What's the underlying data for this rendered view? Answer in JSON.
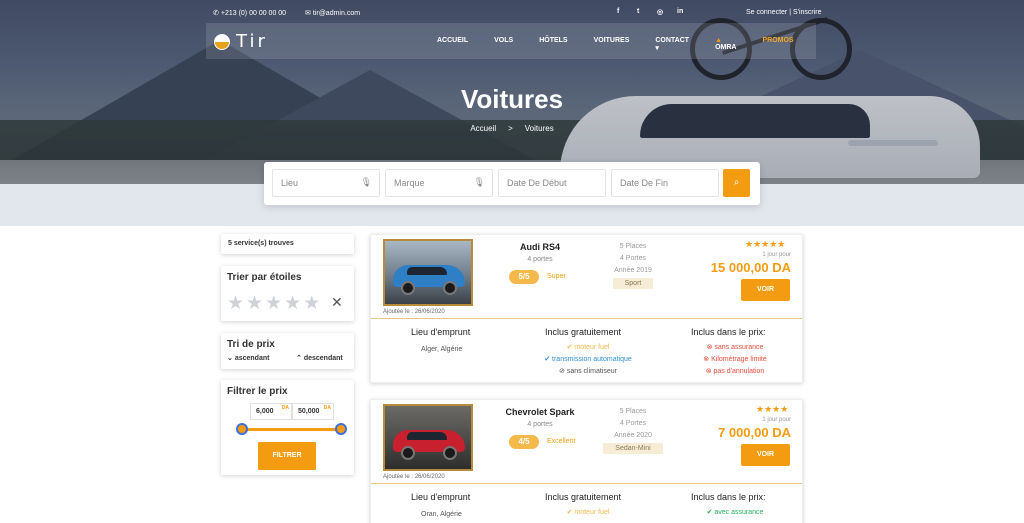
{
  "topbar": {
    "phone": "+213 (0) 00 00 00 00",
    "email": "tir@admin.com",
    "auth": "Se connecter | S'inscrire",
    "social": [
      "f",
      "t",
      "◎",
      "in"
    ]
  },
  "brand": {
    "name": "Tir"
  },
  "nav": {
    "items": [
      "ACCUEIL",
      "VOLS",
      "HÔTELS",
      "VOITURES",
      "CONTACT ▾",
      "OMRA",
      "PROMOS"
    ]
  },
  "hero": {
    "title": "Voitures",
    "breadcrumb": [
      "Accueil",
      ">",
      "Voitures"
    ]
  },
  "search": {
    "lieu": "Lieu",
    "marque": "Marque",
    "date_debut": "Date De Début",
    "date_fin": "Date De Fin"
  },
  "sidebar": {
    "count": "5 service(s) trouves",
    "stars_title": "Trier par étoiles",
    "price_title": "Tri de prix",
    "asc": "ascendant",
    "desc": "descendant",
    "filter_title": "Filtrer le prix",
    "min": "6,000",
    "max": "50,000",
    "currency": "DA",
    "filter_btn": "FILTRER"
  },
  "listings": [
    {
      "name": "Audi RS4",
      "doors": "4 portes",
      "rating": "5/5",
      "rating_label": "Super",
      "places": "5 Places",
      "portes": "4 Portes",
      "year": "Année 2019",
      "category": "Sport",
      "stars": "★★★★★",
      "per": "1 jour pour",
      "price": "15 000,00 DA",
      "voir": "VOIR",
      "added": "Ajoutée le : 26/06/2020",
      "lieu_title": "Lieu d'emprunt",
      "lieu": "Alger, Algérie",
      "inclus_title": "Inclus gratuitement",
      "inclus": [
        "moteur fuel",
        "transmission automatique",
        "sans climatiseur"
      ],
      "prix_title": "Inclus dans le prix:",
      "prix": [
        "sans assurance",
        "Kilométrage limité",
        "pas d'annulation"
      ],
      "car_color": "#2f7fc6"
    },
    {
      "name": "Chevrolet Spark",
      "doors": "4 portes",
      "rating": "4/5",
      "rating_label": "Excellent",
      "places": "5 Places",
      "portes": "4 Portes",
      "year": "Année 2020",
      "category": "Sedan-Mini",
      "stars": "★★★★",
      "per": "1 jour pour",
      "price": "7 000,00 DA",
      "voir": "VOIR",
      "added": "Ajoutée le : 26/06/2020",
      "lieu_title": "Lieu d'emprunt",
      "lieu": "Oran, Algérie",
      "inclus_title": "Inclus gratuitement",
      "inclus": [
        "moteur fuel"
      ],
      "prix_title": "Inclus dans le prix:",
      "prix": [
        "avec assurance"
      ],
      "car_color": "#c8202e"
    }
  ],
  "colors": {
    "accent": "#f39c12"
  }
}
